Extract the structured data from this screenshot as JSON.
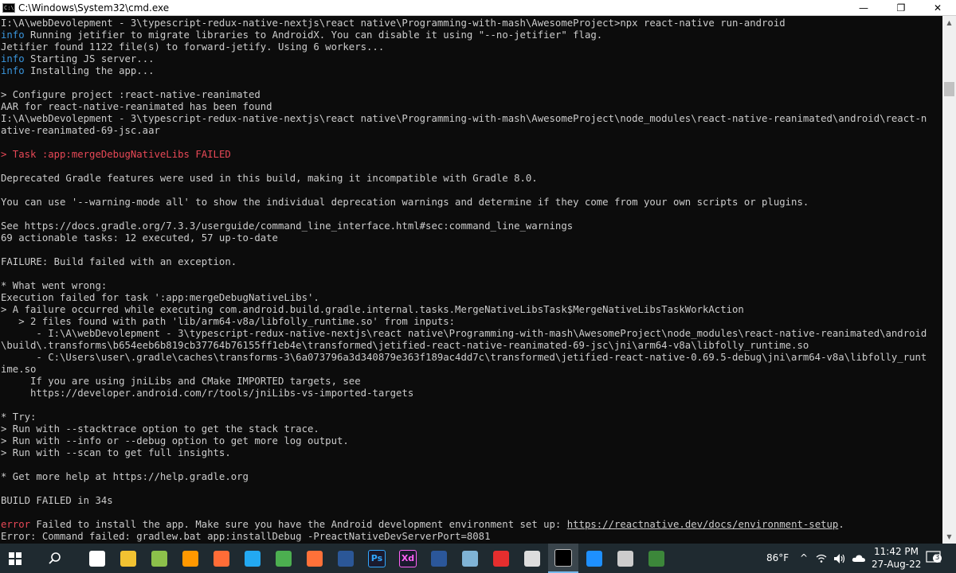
{
  "window": {
    "title": "C:\\Windows\\System32\\cmd.exe",
    "icon_text": "C:\\",
    "controls": {
      "minimize": "—",
      "maximize": "❐",
      "close": "✕"
    }
  },
  "console": {
    "lines": [
      [
        {
          "t": "I:\\A\\webDevolepment - 3\\typescript-redux-native-nextjs\\react native\\Programming-with-mash\\AwesomeProject>npx react-native run-android"
        }
      ],
      [
        {
          "t": "info",
          "c": "info"
        },
        {
          "t": " Running "
        },
        {
          "t": "jetifier",
          "c": "bold"
        },
        {
          "t": " to migrate libraries to AndroidX. You can disable it using \"--no-jetifier\" flag."
        }
      ],
      [
        {
          "t": "Jetifier found 1122 file(s) to forward-jetify. Using 6 workers..."
        }
      ],
      [
        {
          "t": "info",
          "c": "info"
        },
        {
          "t": " Starting JS server..."
        }
      ],
      [
        {
          "t": "info",
          "c": "info"
        },
        {
          "t": " Installing the app..."
        }
      ],
      [],
      [
        {
          "t": "> Configure project :react-native-reanimated"
        }
      ],
      [
        {
          "t": "AAR for react-native-reanimated has been found"
        }
      ],
      [
        {
          "t": "I:\\A\\webDevolepment - 3\\typescript-redux-native-nextjs\\react native\\Programming-with-mash\\AwesomeProject\\node_modules\\react-native-reanimated\\android\\react-n"
        }
      ],
      [
        {
          "t": "ative-reanimated-69-jsc.aar"
        }
      ],
      [],
      [
        {
          "t": "> Task :app:mergeDebugNativeLibs",
          "c": "red"
        },
        {
          "t": " FAILED",
          "c": "red"
        }
      ],
      [],
      [
        {
          "t": "Deprecated Gradle features were used in this build, making it incompatible with Gradle 8.0."
        }
      ],
      [],
      [
        {
          "t": "You can use '--warning-mode all' to show the individual deprecation warnings and determine if they come from your own scripts or plugins."
        }
      ],
      [],
      [
        {
          "t": "See https://docs.gradle.org/7.3.3/userguide/command_line_interface.html#sec:command_line_warnings"
        }
      ],
      [
        {
          "t": "69 actionable tasks: 12 executed, 57 up-to-date"
        }
      ],
      [],
      [
        {
          "t": "FAILURE: Build failed with an exception."
        }
      ],
      [],
      [
        {
          "t": "* What went wrong:"
        }
      ],
      [
        {
          "t": "Execution failed for task ':app:mergeDebugNativeLibs'."
        }
      ],
      [
        {
          "t": "> A failure occurred while executing com.android.build.gradle.internal.tasks.MergeNativeLibsTask$MergeNativeLibsTaskWorkAction"
        }
      ],
      [
        {
          "t": "   > 2 files found with path 'lib/arm64-v8a/libfolly_runtime.so' from inputs:"
        }
      ],
      [
        {
          "t": "      - I:\\A\\webDevolepment - 3\\typescript-redux-native-nextjs\\react native\\Programming-with-mash\\AwesomeProject\\node_modules\\react-native-reanimated\\android"
        }
      ],
      [
        {
          "t": "\\build\\.transforms\\b654eeb6b819cb37764b76155ff1eb4e\\transformed\\jetified-react-native-reanimated-69-jsc\\jni\\arm64-v8a\\libfolly_runtime.so"
        }
      ],
      [
        {
          "t": "      - C:\\Users\\user\\.gradle\\caches\\transforms-3\\6a073796a3d340879e363f189ac4dd7c\\transformed\\jetified-react-native-0.69.5-debug\\jni\\arm64-v8a\\libfolly_runt"
        }
      ],
      [
        {
          "t": "ime.so"
        }
      ],
      [
        {
          "t": "     If you are using jniLibs and CMake IMPORTED targets, see"
        }
      ],
      [
        {
          "t": "     https://developer.android.com/r/tools/jniLibs-vs-imported-targets"
        }
      ],
      [],
      [
        {
          "t": "* Try:"
        }
      ],
      [
        {
          "t": "> Run with --stacktrace option to get the stack trace."
        }
      ],
      [
        {
          "t": "> Run with --info or --debug option to get more log output."
        }
      ],
      [
        {
          "t": "> Run with --scan to get full insights."
        }
      ],
      [],
      [
        {
          "t": "* Get more help at https://help.gradle.org"
        }
      ],
      [],
      [
        {
          "t": "BUILD FAILED in 34s"
        }
      ],
      [],
      [
        {
          "t": "error",
          "c": "red"
        },
        {
          "t": " Failed to install the app. Make sure you have the Android development environment set up: "
        },
        {
          "t": "https://reactnative.dev/docs/environment-setup",
          "c": "link"
        },
        {
          "t": "."
        }
      ],
      [
        {
          "t": "Error: Command failed: gradlew.bat app:installDebug -PreactNativeDevServerPort=8081"
        }
      ]
    ]
  },
  "scrollbar": {
    "up": "▲",
    "down": "▼"
  },
  "taskbar": {
    "apps": [
      {
        "name": "task-view",
        "color": "#ffffff"
      },
      {
        "name": "file-explorer",
        "color": "#f2c232"
      },
      {
        "name": "notepad-plus",
        "color": "#8cc04b"
      },
      {
        "name": "sublime-text",
        "color": "#ff9800"
      },
      {
        "name": "postman",
        "color": "#ff6c37"
      },
      {
        "name": "vs-code",
        "color": "#23a9f2"
      },
      {
        "name": "chrome",
        "color": "#4caf50"
      },
      {
        "name": "firefox",
        "color": "#ff7139"
      },
      {
        "name": "powershell",
        "color": "#2b5797"
      },
      {
        "name": "photoshop",
        "color": "#31a8ff",
        "label": "Ps"
      },
      {
        "name": "adobe-xd",
        "color": "#ff61f6",
        "label": "Xd"
      },
      {
        "name": "word",
        "color": "#2b579a"
      },
      {
        "name": "sticky-notes",
        "color": "#7fb3d5"
      },
      {
        "name": "acrobat",
        "color": "#e62e2e"
      },
      {
        "name": "network-tool",
        "color": "#dddddd"
      },
      {
        "name": "cmd",
        "color": "#000000"
      },
      {
        "name": "app-w",
        "color": "#1e90ff"
      },
      {
        "name": "screen-app",
        "color": "#cccccc"
      },
      {
        "name": "nodejs",
        "color": "#3c873a"
      }
    ],
    "tray": {
      "temperature": "86°F",
      "caret": "^",
      "time": "11:42 PM",
      "date": "27-Aug-22",
      "notifications": "3"
    }
  }
}
